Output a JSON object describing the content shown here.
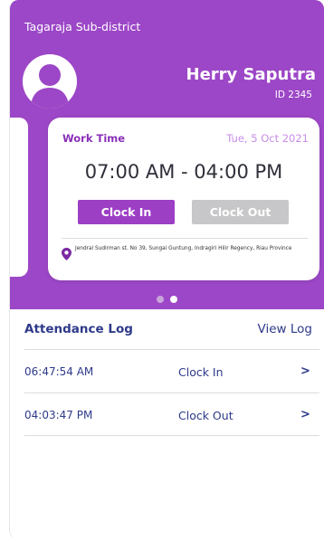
{
  "header": {
    "district": "Tagaraja Sub-district",
    "user_name": "Herry Saputra",
    "user_id": "ID 2345"
  },
  "work_card": {
    "label": "Work Time",
    "date": "Tue, 5 Oct 2021",
    "time_range": "07:00 AM - 04:00 PM",
    "clock_in_label": "Clock In",
    "clock_out_label": "Clock Out",
    "address": "Jendral Sudirman st. No 39, Sungai Guntung, Indragiri Hilir Regency, Riau Province"
  },
  "pager": {
    "active_index": 1,
    "count": 2
  },
  "attendance": {
    "title": "Attendance Log",
    "view_label": "View Log",
    "rows": [
      {
        "time": "06:47:54 AM",
        "type": "Clock In",
        "arrow": ">"
      },
      {
        "time": "04:03:47 PM",
        "type": "Clock Out",
        "arrow": ">"
      }
    ]
  },
  "colors": {
    "brand_purple": "#9c47c7",
    "button_purple": "#9c3fc4",
    "button_disabled": "#c7c7c9",
    "log_text": "#2e3a8a"
  }
}
